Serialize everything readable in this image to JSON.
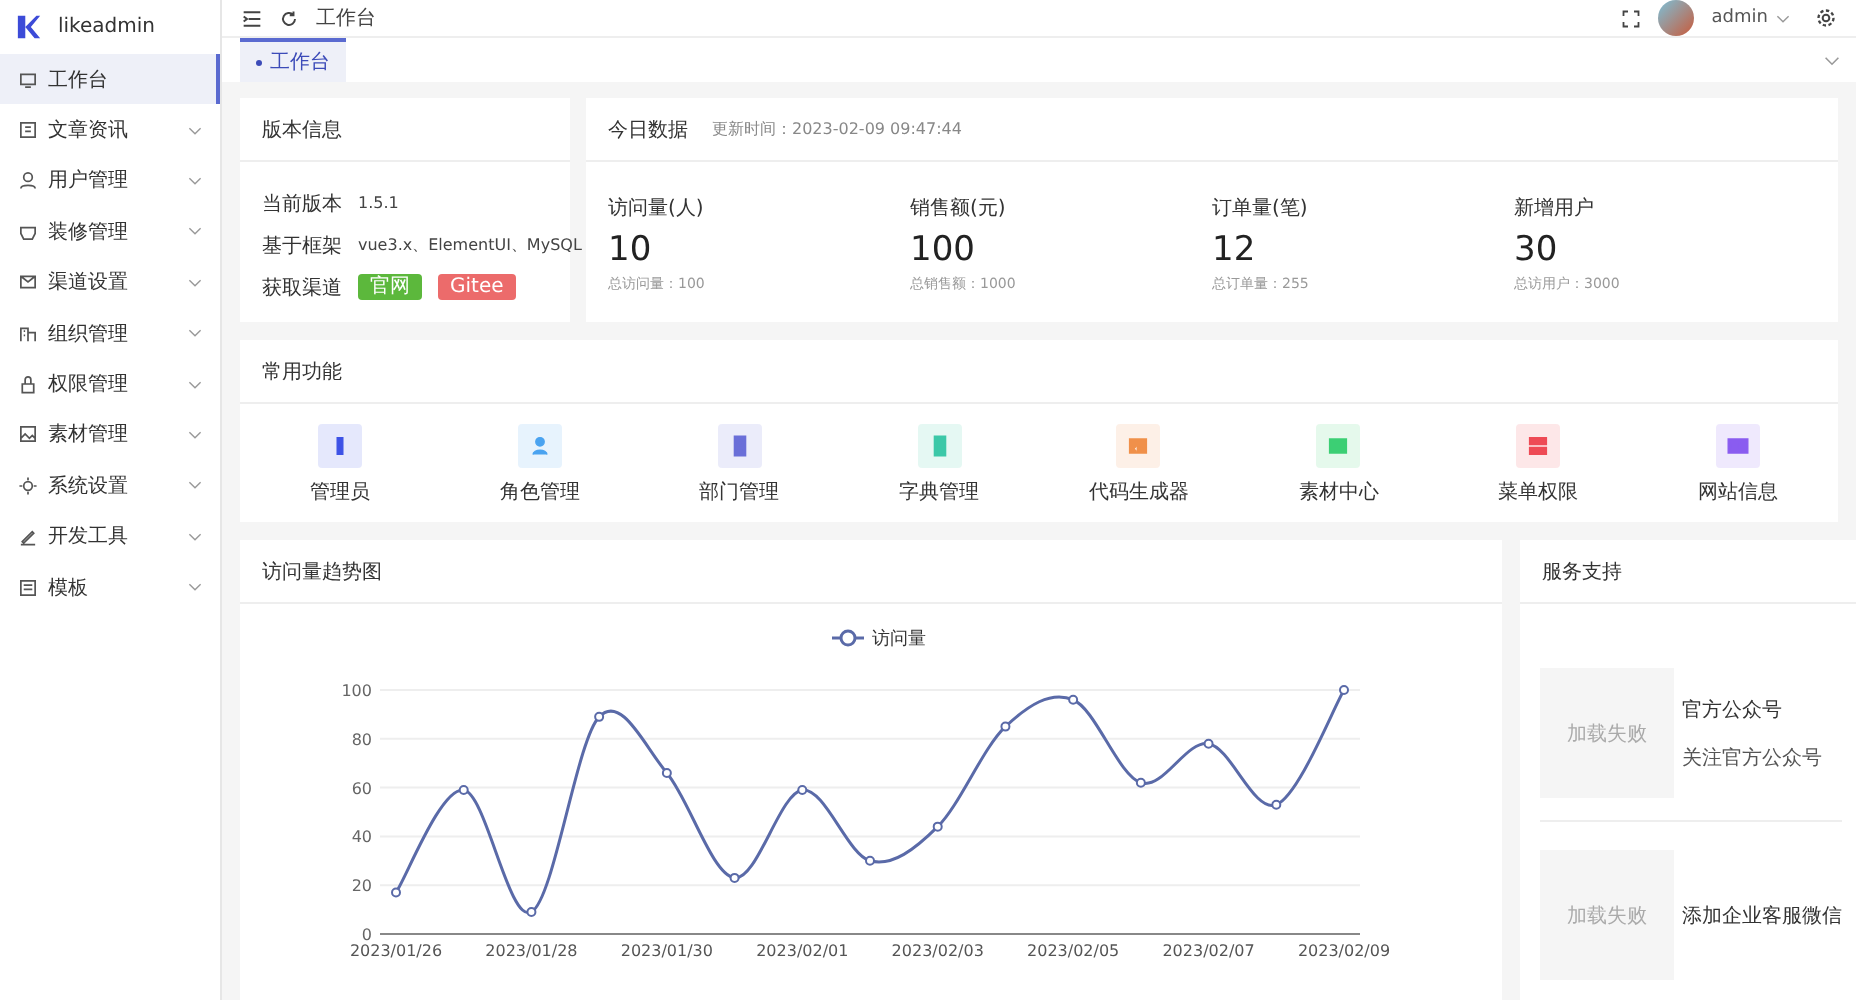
{
  "sidebar": {
    "logo": "likeadmin",
    "items": [
      {
        "label": "工作台",
        "selected": true,
        "expandable": false
      },
      {
        "label": "文章资讯",
        "selected": false,
        "expandable": true
      },
      {
        "label": "用户管理",
        "selected": false,
        "expandable": true
      },
      {
        "label": "装修管理",
        "selected": false,
        "expandable": true
      },
      {
        "label": "渠道设置",
        "selected": false,
        "expandable": true
      },
      {
        "label": "组织管理",
        "selected": false,
        "expandable": true
      },
      {
        "label": "权限管理",
        "selected": false,
        "expandable": true
      },
      {
        "label": "素材管理",
        "selected": false,
        "expandable": true
      },
      {
        "label": "系统设置",
        "selected": false,
        "expandable": true
      },
      {
        "label": "开发工具",
        "selected": false,
        "expandable": true
      },
      {
        "label": "模板",
        "selected": false,
        "expandable": true
      }
    ]
  },
  "header": {
    "breadcrumb": "工作台",
    "user": "admin"
  },
  "tabs": [
    {
      "label": "工作台",
      "selected": true
    }
  ],
  "version_card": {
    "title": "版本信息",
    "rows": [
      {
        "label": "当前版本",
        "value": "1.5.1"
      },
      {
        "label": "基于框架",
        "value": "vue3.x、ElementUI、MySQL"
      }
    ],
    "channel_label": "获取渠道",
    "channels": [
      {
        "label": "官网",
        "color": "#5cb83c"
      },
      {
        "label": "Gitee",
        "color": "#ec6b6b"
      }
    ]
  },
  "today_card": {
    "title": "今日数据",
    "updated": "更新时间：2023-02-09 09:47:44",
    "stats": [
      {
        "label": "访问量(人)",
        "value": "10",
        "total": "总访问量：100"
      },
      {
        "label": "销售额(元)",
        "value": "100",
        "total": "总销售额：1000"
      },
      {
        "label": "订单量(笔)",
        "value": "12",
        "total": "总订单量：255"
      },
      {
        "label": "新增用户",
        "value": "30",
        "total": "总访用户：3000"
      }
    ]
  },
  "shortcuts_card": {
    "title": "常用功能",
    "items": [
      {
        "label": "管理员",
        "color": "#3d52e6"
      },
      {
        "label": "角色管理",
        "color": "#4aa3f0"
      },
      {
        "label": "部门管理",
        "color": "#6a6fd8"
      },
      {
        "label": "字典管理",
        "color": "#3cc8a8"
      },
      {
        "label": "代码生成器",
        "color": "#f0904a"
      },
      {
        "label": "素材中心",
        "color": "#3ccf74"
      },
      {
        "label": "菜单权限",
        "color": "#ee4a55"
      },
      {
        "label": "网站信息",
        "color": "#8a5cf0"
      }
    ]
  },
  "trend_card": {
    "title": "访问量趋势图",
    "chart_data": {
      "type": "line",
      "categories": [
        "2023/01/26",
        null,
        "2023/01/28",
        null,
        "2023/01/30",
        null,
        "2023/02/01",
        null,
        "2023/02/03",
        null,
        "2023/02/05",
        null,
        "2023/02/07",
        null,
        "2023/02/09"
      ],
      "series": [
        {
          "name": "访问量",
          "color": "#5a6aa8",
          "marker": "circle",
          "values": [
            17,
            59,
            9,
            89,
            66,
            23,
            59,
            30,
            44,
            85,
            96,
            62,
            78,
            53,
            100
          ]
        }
      ],
      "grid": true,
      "ylim": [
        0,
        100
      ],
      "yticks": [
        0,
        20,
        40,
        60,
        80,
        100
      ]
    }
  },
  "support_card": {
    "title": "服务支持",
    "items": [
      {
        "image_text": "加载失败",
        "title": "官方公众号",
        "subtitle": "关注官方公众号"
      },
      {
        "image_text": "加载失败",
        "title": "添加企业客服微信"
      }
    ]
  }
}
